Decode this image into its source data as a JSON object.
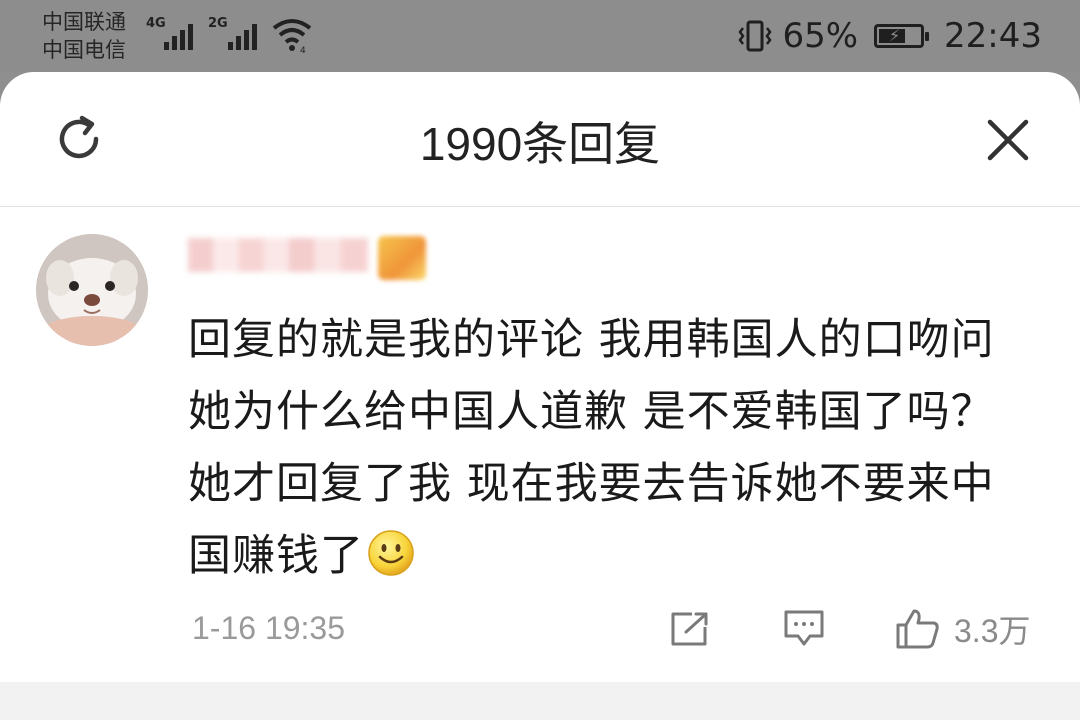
{
  "status_bar": {
    "carrier_1": "中国联通",
    "carrier_2": "中国电信",
    "network_1": "4G",
    "network_2": "2G",
    "battery_percent": "65%",
    "battery_level": 0.65,
    "time": "22:43",
    "icons": [
      "signal-icon",
      "wifi-icon",
      "vibrate-icon",
      "battery-icon"
    ]
  },
  "sheet": {
    "title": "1990条回复",
    "refresh_icon": "refresh-icon",
    "close_icon": "close-icon"
  },
  "comment": {
    "text": "回复的就是我的评论 我用韩国人的口吻问她为什么给中国人道歉 是不爱韩国了吗？ 她才回复了我 现在我要去告诉她不要来中国赚钱了",
    "emoji": "smile-emoji",
    "timestamp": "1-16 19:35",
    "likes": "3.3万",
    "actions": [
      "share-icon",
      "comment-icon",
      "like-icon"
    ]
  },
  "colors": {
    "status_bar_bg": "#8d8d8d",
    "sheet_bg": "#ffffff",
    "text_primary": "#1a1a1a",
    "text_secondary": "#9a9a9a",
    "divider": "#e2e2e2"
  }
}
